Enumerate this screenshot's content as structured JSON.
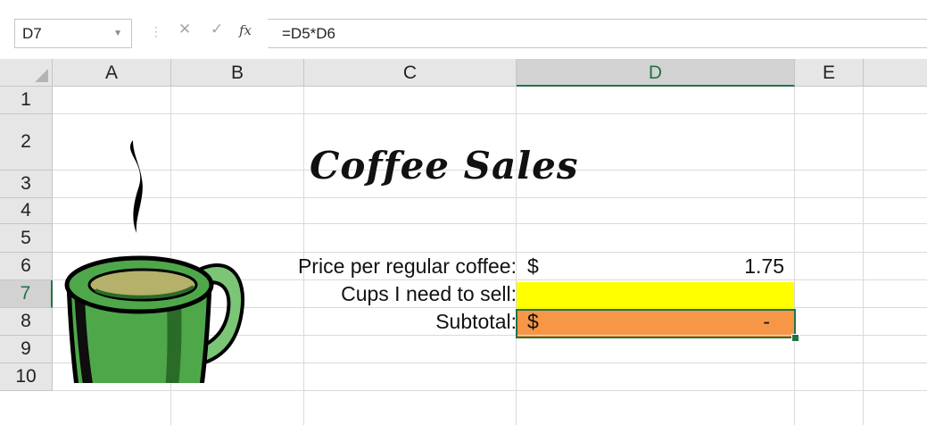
{
  "formula_bar": {
    "name_box": "D7",
    "cancel_glyph": "✕",
    "enter_glyph": "✓",
    "fx_label": "fx",
    "formula": "=D5*D6"
  },
  "columns": [
    "A",
    "B",
    "C",
    "D",
    "E"
  ],
  "rows": [
    "1",
    "2",
    "3",
    "4",
    "5",
    "6",
    "7",
    "8",
    "9",
    "10"
  ],
  "selection": {
    "column": "D",
    "row": "7"
  },
  "cells": {
    "C2": "Coffee Sales",
    "C5": "Price per regular coffee:",
    "D5_currency": "$",
    "D5_value": "1.75",
    "C6": "Cups I need to sell:",
    "C7": "Subtotal:",
    "D7_currency": "$",
    "D7_value": "-"
  },
  "colors": {
    "selection": "#217346",
    "yellow_fill": "#ffff00",
    "orange_fill": "#f79646",
    "mug_green": "#4ea84a"
  },
  "images": {
    "mug": "coffee-mug-clipart"
  }
}
